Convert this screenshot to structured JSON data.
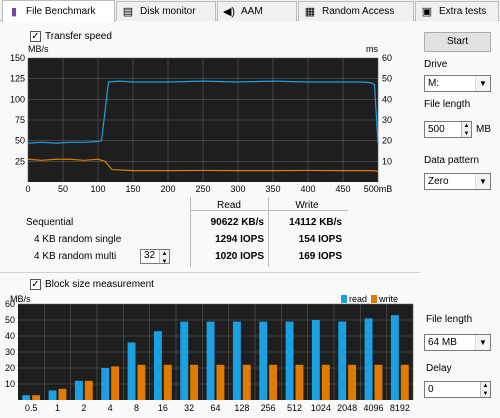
{
  "tabs": [
    {
      "label": "File Benchmark",
      "icon": "benchmark-icon"
    },
    {
      "label": "Disk monitor",
      "icon": "monitor-icon"
    },
    {
      "label": "AAM",
      "icon": "speaker-icon"
    },
    {
      "label": "Random Access",
      "icon": "random-access-icon"
    },
    {
      "label": "Extra tests",
      "icon": "extra-tests-icon"
    }
  ],
  "transfer": {
    "checkbox_label": "Transfer speed",
    "left_unit": "MB/s",
    "right_unit": "ms",
    "x_unit_suffix": "mB"
  },
  "results": {
    "col_read": "Read",
    "col_write": "Write",
    "rows": [
      {
        "label": "Sequential",
        "read": "90622 KB/s",
        "write": "14112 KB/s"
      },
      {
        "label": "4 KB random single",
        "read": "1294 IOPS",
        "write": "154 IOPS"
      },
      {
        "label": "4 KB random multi",
        "read": "1020 IOPS",
        "write": "169 IOPS"
      }
    ],
    "queue_depth": "32"
  },
  "block": {
    "checkbox_label": "Block size measurement",
    "unit": "MB/s",
    "legend_read": "read",
    "legend_write": "write"
  },
  "side": {
    "start_label": "Start",
    "drive_label": "Drive",
    "drive_value": "M:",
    "file_length_label": "File length",
    "file_length_value": "500",
    "file_length_unit": "MB",
    "pattern_label": "Data pattern",
    "pattern_value": "Zero",
    "block_file_length_label": "File length",
    "block_file_length_value": "64 MB",
    "delay_label": "Delay",
    "delay_value": "0"
  },
  "colors": {
    "read": "#1ba1e2",
    "write": "#e07b00",
    "chart_bg": "#1e1e1e",
    "grid": "#5a5a5a"
  },
  "chart_data": [
    {
      "type": "line",
      "title": "Transfer speed",
      "xlabel": "mB",
      "x_ticks": [
        "0",
        "50",
        "100",
        "150",
        "200",
        "250",
        "300",
        "350",
        "400",
        "450",
        "500mB"
      ],
      "y_left_ticks": [
        "150",
        "125",
        "100",
        "75",
        "50",
        "25"
      ],
      "y_right_ticks": [
        "60",
        "50",
        "40",
        "30",
        "20",
        "10"
      ],
      "xlim": [
        0,
        500
      ],
      "ylim_left": [
        0,
        150
      ],
      "ylim_right": [
        0,
        60
      ],
      "series": [
        {
          "axis": "left",
          "color": "#1ba1e2",
          "x": [
            0,
            20,
            40,
            60,
            80,
            100,
            105,
            110,
            115,
            130,
            150,
            200,
            250,
            300,
            350,
            400,
            450,
            480,
            490,
            495,
            500
          ],
          "y": [
            47,
            48,
            47,
            48,
            48,
            49,
            50,
            85,
            121,
            122,
            121,
            121,
            122,
            121,
            122,
            121,
            121,
            121,
            120,
            118,
            47
          ]
        },
        {
          "axis": "right",
          "color": "#e07b00",
          "x": [
            0,
            20,
            40,
            60,
            80,
            100,
            110,
            120,
            150,
            200,
            250,
            300,
            350,
            400,
            450,
            480,
            495,
            500
          ],
          "y": [
            11,
            10.5,
            11,
            11,
            10.5,
            11,
            10,
            6,
            5.5,
            5.5,
            5.6,
            5.5,
            5.5,
            5.6,
            5.5,
            5.5,
            5.5,
            5
          ]
        }
      ],
      "grid": true
    },
    {
      "type": "bar",
      "title": "Block size measurement",
      "ylabel": "MB/s",
      "categories": [
        "0.5",
        "1",
        "2",
        "4",
        "8",
        "16",
        "32",
        "64",
        "128",
        "256",
        "512",
        "1024",
        "2048",
        "4096",
        "8192"
      ],
      "y_ticks": [
        "60",
        "50",
        "40",
        "30",
        "20",
        "10"
      ],
      "ylim": [
        0,
        60
      ],
      "series": [
        {
          "name": "read",
          "color": "#1ba1e2",
          "values": [
            3,
            6,
            12,
            20,
            36,
            43,
            49,
            49,
            49,
            49,
            49,
            50,
            49,
            51,
            53
          ]
        },
        {
          "name": "write",
          "color": "#e07b00",
          "values": [
            3,
            7,
            12,
            21,
            22,
            22,
            22,
            22,
            22,
            22,
            22,
            22,
            22,
            22,
            22
          ]
        }
      ],
      "legend": "top-right",
      "grid": true
    }
  ]
}
